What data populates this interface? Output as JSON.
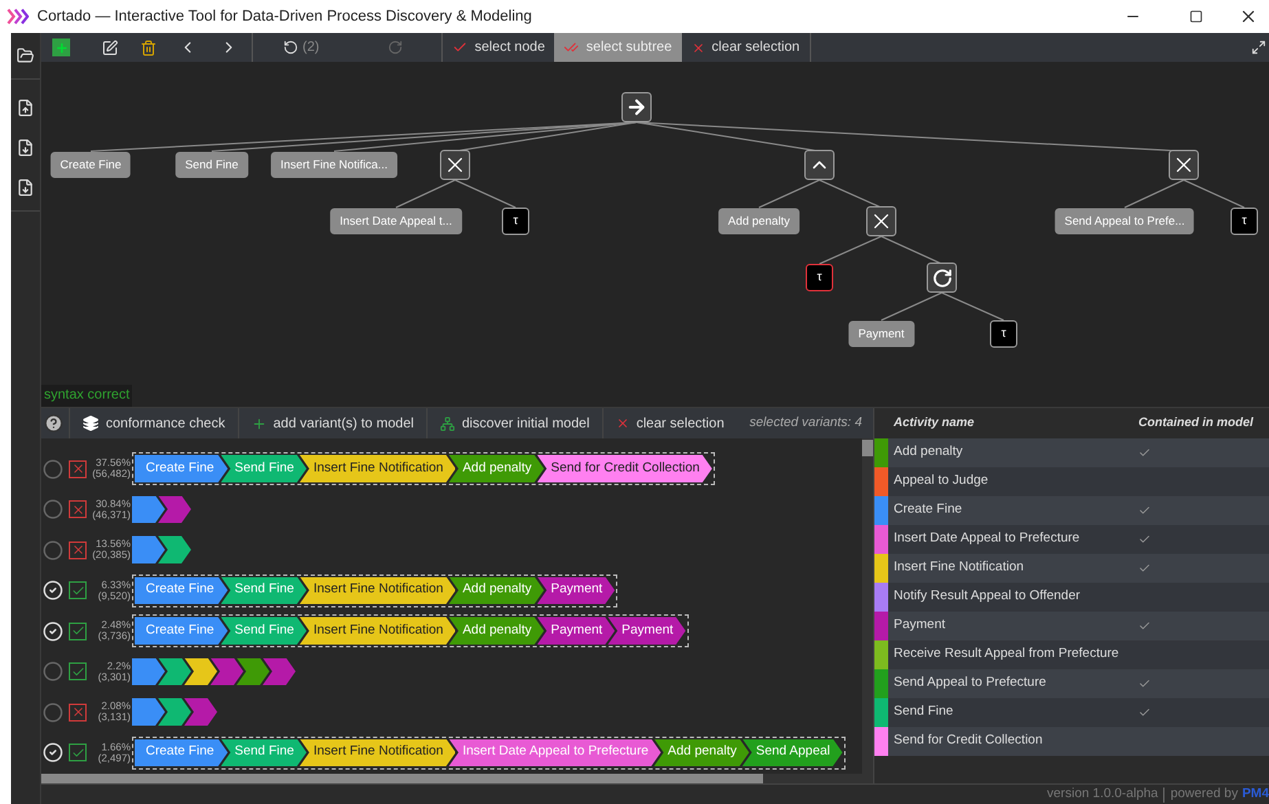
{
  "window": {
    "title": "Cortado — Interactive Tool for Data-Driven Process Discovery & Modeling"
  },
  "toolbar": {
    "undo_count": "(2)",
    "redo_disabled": true,
    "tree_tools": [
      {
        "label": "select node",
        "kind": "check",
        "selected": false
      },
      {
        "label": "select subtree",
        "kind": "double-check",
        "selected": true
      },
      {
        "label": "clear selection",
        "kind": "clear",
        "selected": false
      }
    ]
  },
  "process_tree": {
    "kind": "sequence",
    "selected": false,
    "children": [
      {
        "kind": "activity",
        "label": "Create Fine",
        "selected": false
      },
      {
        "kind": "activity",
        "label": "Send Fine",
        "selected": false
      },
      {
        "kind": "activity",
        "label": "Insert Fine Notifica...",
        "selected": false
      },
      {
        "kind": "xor",
        "selected": false,
        "children": [
          {
            "kind": "activity",
            "label": "Insert Date Appeal t...",
            "selected": false
          },
          {
            "kind": "tau",
            "label": "τ",
            "selected": false
          }
        ]
      },
      {
        "kind": "parallel",
        "selected": false,
        "children": [
          {
            "kind": "activity",
            "label": "Add penalty",
            "selected": false
          },
          {
            "kind": "xor",
            "selected": false,
            "children": [
              {
                "kind": "tau",
                "label": "τ",
                "selected": true
              },
              {
                "kind": "loop",
                "selected": false,
                "children": [
                  {
                    "kind": "activity",
                    "label": "Payment",
                    "selected": false
                  },
                  {
                    "kind": "tau",
                    "label": "τ",
                    "selected": false
                  }
                ]
              }
            ]
          }
        ]
      },
      {
        "kind": "xor",
        "selected": false,
        "children": [
          {
            "kind": "activity",
            "label": "Send Appeal to Prefe...",
            "selected": false
          },
          {
            "kind": "tau",
            "label": "τ",
            "selected": false
          }
        ]
      }
    ]
  },
  "syntax_status": "syntax correct",
  "variant_toolbar": {
    "buttons": [
      {
        "label": "conformance check",
        "kind": "layers"
      },
      {
        "label": "add variant(s) to model",
        "kind": "add"
      },
      {
        "label": "discover initial model",
        "kind": "tree"
      },
      {
        "label": "clear selection",
        "kind": "clear"
      }
    ],
    "selection_info": "selected variants: 4"
  },
  "variants": [
    {
      "selected": false,
      "fits": false,
      "percent": "37.56%",
      "count": "(56,482)",
      "expanded": true,
      "activities": [
        {
          "label": "Create Fine",
          "color": "#3a8ef6"
        },
        {
          "label": "Send Fine",
          "color": "#0fb872"
        },
        {
          "label": "Insert Fine Notification",
          "color": "#e6c619"
        },
        {
          "label": "Add penalty",
          "color": "#3f9a06"
        },
        {
          "label": "Send for Credit Collection",
          "color": "#ff80f0"
        }
      ]
    },
    {
      "selected": false,
      "fits": false,
      "percent": "30.84%",
      "count": "(46,371)",
      "expanded": false,
      "activities": [
        {
          "color": "#3a8ef6"
        },
        {
          "color": "#b51aa8"
        }
      ]
    },
    {
      "selected": false,
      "fits": false,
      "percent": "13.56%",
      "count": "(20,385)",
      "expanded": false,
      "activities": [
        {
          "color": "#3a8ef6"
        },
        {
          "color": "#0fb872"
        }
      ]
    },
    {
      "selected": true,
      "fits": true,
      "percent": "6.33%",
      "count": "(9,520)",
      "expanded": true,
      "activities": [
        {
          "label": "Create Fine",
          "color": "#3a8ef6"
        },
        {
          "label": "Send Fine",
          "color": "#0fb872"
        },
        {
          "label": "Insert Fine Notification",
          "color": "#e6c619"
        },
        {
          "label": "Add penalty",
          "color": "#3f9a06"
        },
        {
          "label": "Payment",
          "color": "#b51aa8"
        }
      ]
    },
    {
      "selected": true,
      "fits": true,
      "percent": "2.48%",
      "count": "(3,736)",
      "expanded": true,
      "activities": [
        {
          "label": "Create Fine",
          "color": "#3a8ef6"
        },
        {
          "label": "Send Fine",
          "color": "#0fb872"
        },
        {
          "label": "Insert Fine Notification",
          "color": "#e6c619"
        },
        {
          "label": "Add penalty",
          "color": "#3f9a06"
        },
        {
          "label": "Payment",
          "color": "#b51aa8"
        },
        {
          "label": "Payment",
          "color": "#b51aa8"
        }
      ]
    },
    {
      "selected": false,
      "fits": true,
      "percent": "2.2%",
      "count": "(3,301)",
      "expanded": false,
      "activities": [
        {
          "color": "#3a8ef6"
        },
        {
          "color": "#0fb872"
        },
        {
          "color": "#e6c619"
        },
        {
          "color": "#b51aa8"
        },
        {
          "color": "#3f9a06"
        },
        {
          "color": "#b51aa8"
        }
      ]
    },
    {
      "selected": false,
      "fits": false,
      "percent": "2.08%",
      "count": "(3,131)",
      "expanded": false,
      "activities": [
        {
          "color": "#3a8ef6"
        },
        {
          "color": "#0fb872"
        },
        {
          "color": "#b51aa8"
        }
      ]
    },
    {
      "selected": true,
      "fits": true,
      "percent": "1.66%",
      "count": "(2,497)",
      "expanded": true,
      "activities": [
        {
          "label": "Create Fine",
          "color": "#3a8ef6"
        },
        {
          "label": "Send Fine",
          "color": "#0fb872"
        },
        {
          "label": "Insert Fine Notification",
          "color": "#e6c619"
        },
        {
          "label": "Insert Date Appeal to Prefecture",
          "color": "#e85ad4"
        },
        {
          "label": "Add penalty",
          "color": "#3f9a06"
        },
        {
          "label": "Send Appeal",
          "color": "#22a01d"
        }
      ]
    }
  ],
  "activity_table": {
    "columns": [
      "Activity name",
      "Contained in model"
    ],
    "rows": [
      {
        "name": "Add penalty",
        "color": "#3f9a06",
        "contained": true
      },
      {
        "name": "Appeal to Judge",
        "color": "#f05a28",
        "contained": false
      },
      {
        "name": "Create Fine",
        "color": "#3a8ef6",
        "contained": true
      },
      {
        "name": "Insert Date Appeal to Prefecture",
        "color": "#e85ad4",
        "contained": true
      },
      {
        "name": "Insert Fine Notification",
        "color": "#e6c619",
        "contained": true
      },
      {
        "name": "Notify Result Appeal to Offender",
        "color": "#a87cf5",
        "contained": false
      },
      {
        "name": "Payment",
        "color": "#b51aa8",
        "contained": true
      },
      {
        "name": "Receive Result Appeal from Prefecture",
        "color": "#7dbb1f",
        "contained": false
      },
      {
        "name": "Send Appeal to Prefecture",
        "color": "#22a01d",
        "contained": true
      },
      {
        "name": "Send Fine",
        "color": "#0fb872",
        "contained": true
      },
      {
        "name": "Send for Credit Collection",
        "color": "#ff80f0",
        "contained": false
      }
    ]
  },
  "status_bar": {
    "version": "version 1.0.0-alpha",
    "powered_by": "powered by",
    "logo": "PM4"
  }
}
